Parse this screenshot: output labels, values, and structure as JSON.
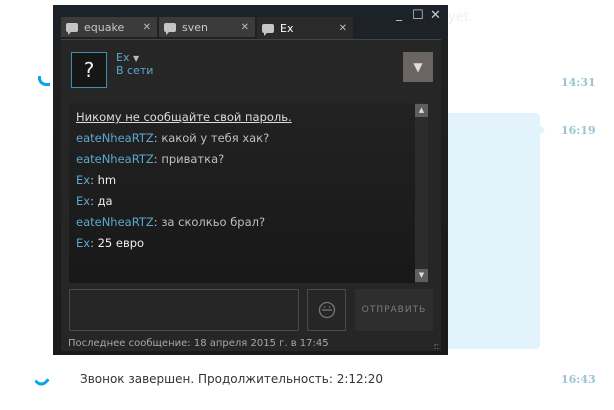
{
  "background": {
    "faint_text": "yet.",
    "times": [
      "14:31",
      "16:19",
      "16:43"
    ],
    "call_ended": "Звонок завершен. Продолжительность: 2:12:20"
  },
  "window": {
    "tabs": [
      {
        "label": "equake"
      },
      {
        "label": "sven"
      },
      {
        "label": "Ex"
      }
    ],
    "controls": {
      "minimize": "_",
      "maximize": "☐",
      "close": "✕"
    },
    "friend": {
      "avatar": "?",
      "name": "Ex",
      "status": "В сети"
    },
    "messages": [
      {
        "nick": "",
        "text": "Никому не сообщайте свой пароль.",
        "self": false
      },
      {
        "nick": "eateNheaRTZ",
        "text": "какой у тебя хак?",
        "self": false
      },
      {
        "nick": "eateNheaRTZ",
        "text": "приватка?",
        "self": false
      },
      {
        "nick": "Ex",
        "text": "hm",
        "self": true
      },
      {
        "nick": "Ex",
        "text": "да",
        "self": true
      },
      {
        "nick": "eateNheaRTZ",
        "text": "за сколкьо брал?",
        "self": false
      },
      {
        "nick": "Ex",
        "text": "25 евро",
        "self": true
      }
    ],
    "input": {
      "value": ""
    },
    "send_label": "ОТПРАВИТЬ",
    "last_message": "Последнее сообщение: 18 апреля 2015 г. в 17:45"
  },
  "colors": {
    "accent": "#5aa9cf",
    "skype_time": "#9cc4d6",
    "bubble": "#e3f3fb"
  }
}
